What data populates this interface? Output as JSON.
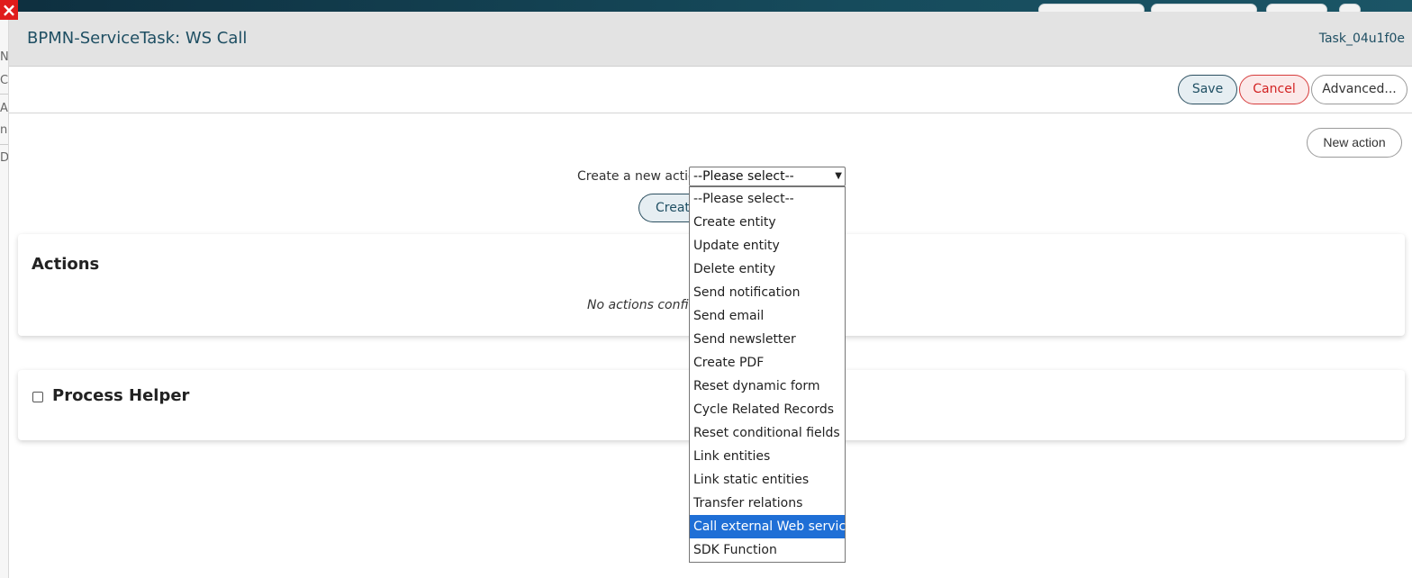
{
  "modal": {
    "title": "BPMN-ServiceTask: WS Call",
    "task_id": "Task_04u1f0e"
  },
  "toolbar": {
    "save_label": "Save",
    "cancel_label": "Cancel",
    "advanced_label": "Advanced..."
  },
  "new_action_label": "New action",
  "create_form": {
    "label": "Create a new action",
    "selected_value": "--Please select--",
    "create_button_label": "Create"
  },
  "dropdown": {
    "options": [
      "--Please select--",
      "Create entity",
      "Update entity",
      "Delete entity",
      "Send notification",
      "Send email",
      "Send newsletter",
      "Create PDF",
      "Reset dynamic form",
      "Cycle Related Records",
      "Reset conditional fields",
      "Link entities",
      "Link static entities",
      "Transfer relations",
      "Call external Web service",
      "SDK Function"
    ],
    "highlighted_index": 14
  },
  "actions_panel": {
    "title": "Actions",
    "empty_text": "No actions configured"
  },
  "helper_panel": {
    "title": "Process Helper"
  },
  "background": {
    "left_rows": [
      "N",
      "Ca",
      "Ac",
      "nc",
      "D"
    ]
  },
  "colors": {
    "accent": "#1f4f63",
    "danger": "#d22222",
    "highlight": "#1f6fd6"
  }
}
